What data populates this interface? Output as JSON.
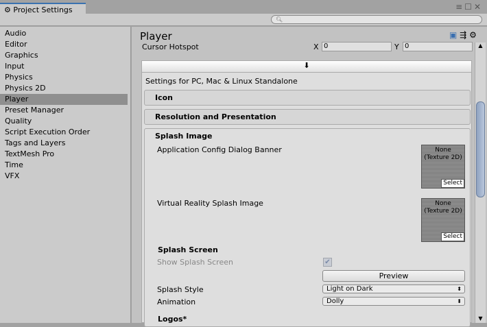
{
  "window": {
    "title": "Project Settings",
    "search_placeholder": "",
    "buttons": [
      "menu",
      "maximize",
      "close"
    ]
  },
  "sidebar": {
    "items": [
      {
        "label": "Audio"
      },
      {
        "label": "Editor"
      },
      {
        "label": "Graphics"
      },
      {
        "label": "Input"
      },
      {
        "label": "Physics"
      },
      {
        "label": "Physics 2D"
      },
      {
        "label": "Player",
        "selected": true
      },
      {
        "label": "Preset Manager"
      },
      {
        "label": "Quality"
      },
      {
        "label": "Script Execution Order"
      },
      {
        "label": "Tags and Layers"
      },
      {
        "label": "TextMesh Pro"
      },
      {
        "label": "Time"
      },
      {
        "label": "VFX"
      }
    ]
  },
  "main": {
    "title": "Player",
    "cursor_hotspot": {
      "label": "Cursor Hotspot",
      "x_label": "X",
      "x_value": "0",
      "y_label": "Y",
      "y_value": "0"
    },
    "platform_label": "Settings for PC, Mac & Linux Standalone",
    "sections": {
      "icon": "Icon",
      "resolution": "Resolution and Presentation",
      "splash": "Splash Image"
    },
    "splash": {
      "banner_label": "Application Config Dialog Banner",
      "vr_label": "Virtual Reality Splash Image",
      "texture_none": "None (Texture 2D)",
      "select_label": "Select",
      "splash_screen_heading": "Splash Screen",
      "show_splash_label": "Show Splash Screen",
      "show_splash_checked": true,
      "preview_label": "Preview",
      "style_label": "Splash Style",
      "style_value": "Light on Dark",
      "animation_label": "Animation",
      "animation_value": "Dolly",
      "logos_label": "Logos*"
    }
  }
}
